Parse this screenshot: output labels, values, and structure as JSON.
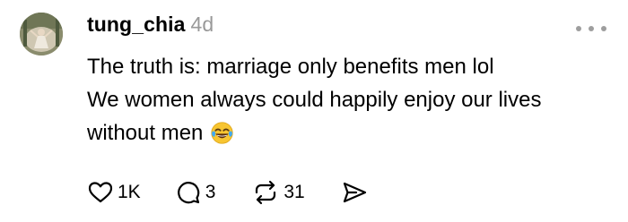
{
  "post": {
    "author": {
      "username": "tung_chia",
      "avatar_icon": "profile-photo-avatar"
    },
    "timestamp": "4d",
    "more_icon": "more-options-icon",
    "text_lines": [
      "The truth is: marriage only benefits men lol",
      "We women always could happily enjoy our lives",
      "without men"
    ],
    "emoji": "face-with-tears-of-joy",
    "actions": {
      "like": {
        "icon": "heart-icon",
        "count": "1K"
      },
      "reply": {
        "icon": "comment-icon",
        "count": "3"
      },
      "repost": {
        "icon": "repost-icon",
        "count": "31"
      },
      "share": {
        "icon": "share-icon"
      }
    }
  },
  "colors": {
    "text": "#000000",
    "muted": "#999999",
    "emoji_face": "#f7c531",
    "emoji_tears": "#3fa9f5"
  }
}
